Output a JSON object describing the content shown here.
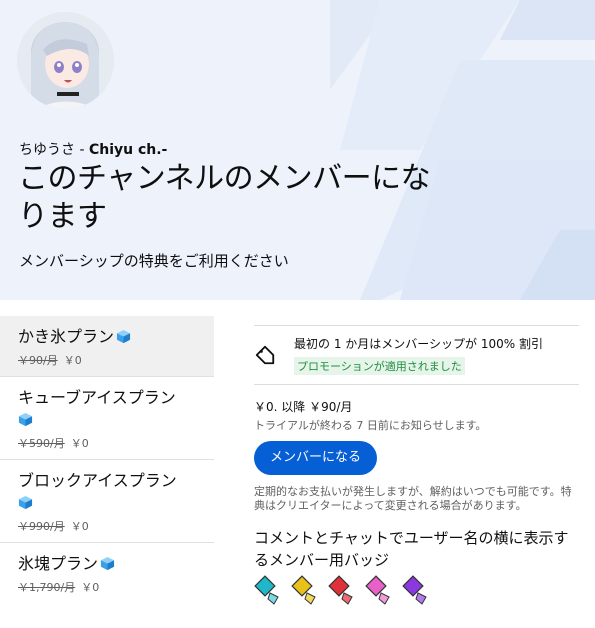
{
  "header": {
    "channel_name_jp": "ちゆうさ - ",
    "channel_name_en": "Chiyu ch.-",
    "title": "このチャンネルのメンバーになります",
    "subtitle": "メンバーシップの特典をご利用ください"
  },
  "plans": [
    {
      "name": "かき氷プラン",
      "original_price": "￥90/月",
      "price": "￥0",
      "selected": true
    },
    {
      "name": "キューブアイスプラン",
      "original_price": "￥590/月",
      "price": "￥0",
      "selected": false
    },
    {
      "name": "ブロックアイスプラン",
      "original_price": "￥990/月",
      "price": "￥0",
      "selected": false
    },
    {
      "name": "氷塊プラン",
      "original_price": "￥1,790/月",
      "price": "￥0",
      "selected": false
    }
  ],
  "offer": {
    "promo_text": "最初の 1 か月はメンバーシップが 100% 割引",
    "promo_badge": "プロモーションが適用されました",
    "price_line": "￥0. 以降 ￥90/月",
    "trial_note": "トライアルが終わる 7 日前にお知らせします。",
    "join_label": "メンバーになる",
    "disclaimer": "定期的なお支払いが発生しますが、解約はいつでも可能です。特典はクリエイターによって変更される場合があります。",
    "badges_title": "コメントとチャットでユーザー名の横に表示するメンバー用バッジ",
    "badge_colors": [
      "#1fb8c8",
      "#e8c21a",
      "#e0303a",
      "#e860c8",
      "#8a38e0"
    ]
  },
  "colors": {
    "accent": "#065fd4",
    "header_bg": "#edf2fb",
    "promo_green": "#1e8e3e",
    "cube": "#3aa0e8"
  }
}
